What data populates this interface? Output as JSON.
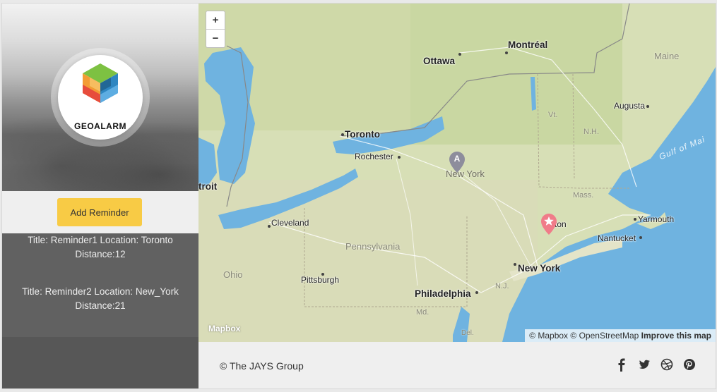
{
  "app": {
    "logo_text": "GEOALARM"
  },
  "sidebar": {
    "add_button_label": "Add Reminder",
    "reminders": [
      {
        "line1": "Title: Reminder1 Location: Toronto",
        "line2": "Distance:12"
      },
      {
        "line1": "Title: Reminder2 Location: New_York",
        "line2": "Distance:21"
      }
    ]
  },
  "map": {
    "zoom_in": "+",
    "zoom_out": "−",
    "marker_a_label": "A",
    "mapbox_logo": "Mapbox",
    "attribution": {
      "mapbox": "© Mapbox",
      "osm": "© OpenStreetMap",
      "improve": "Improve this map"
    },
    "labels": {
      "ottawa": "Ottawa",
      "montreal": "Montréal",
      "maine": "Maine",
      "augusta": "Augusta",
      "vt": "Vt.",
      "nh": "N.H.",
      "gulf_of_maine": "Gulf of Mai",
      "toronto": "Toronto",
      "rochester": "Rochester",
      "new_york_state": "New York",
      "detroit": "troit",
      "mass": "Mass.",
      "boston": "ston",
      "yarmouth": "Yarmouth",
      "nantucket": "Nantucket",
      "cleveland": "Cleveland",
      "pennsylvania": "Pennsylvania",
      "ohio": "Ohio",
      "pittsburgh": "Pittsburgh",
      "new_york_city": "New York",
      "nj": "N.J.",
      "philadelphia": "Philadelphia",
      "md": "Md.",
      "del": "Del."
    }
  },
  "footer": {
    "copyright": "© The JAYS Group",
    "social_icons": [
      "facebook-icon",
      "twitter-icon",
      "dribbble-icon",
      "pinterest-icon"
    ]
  }
}
